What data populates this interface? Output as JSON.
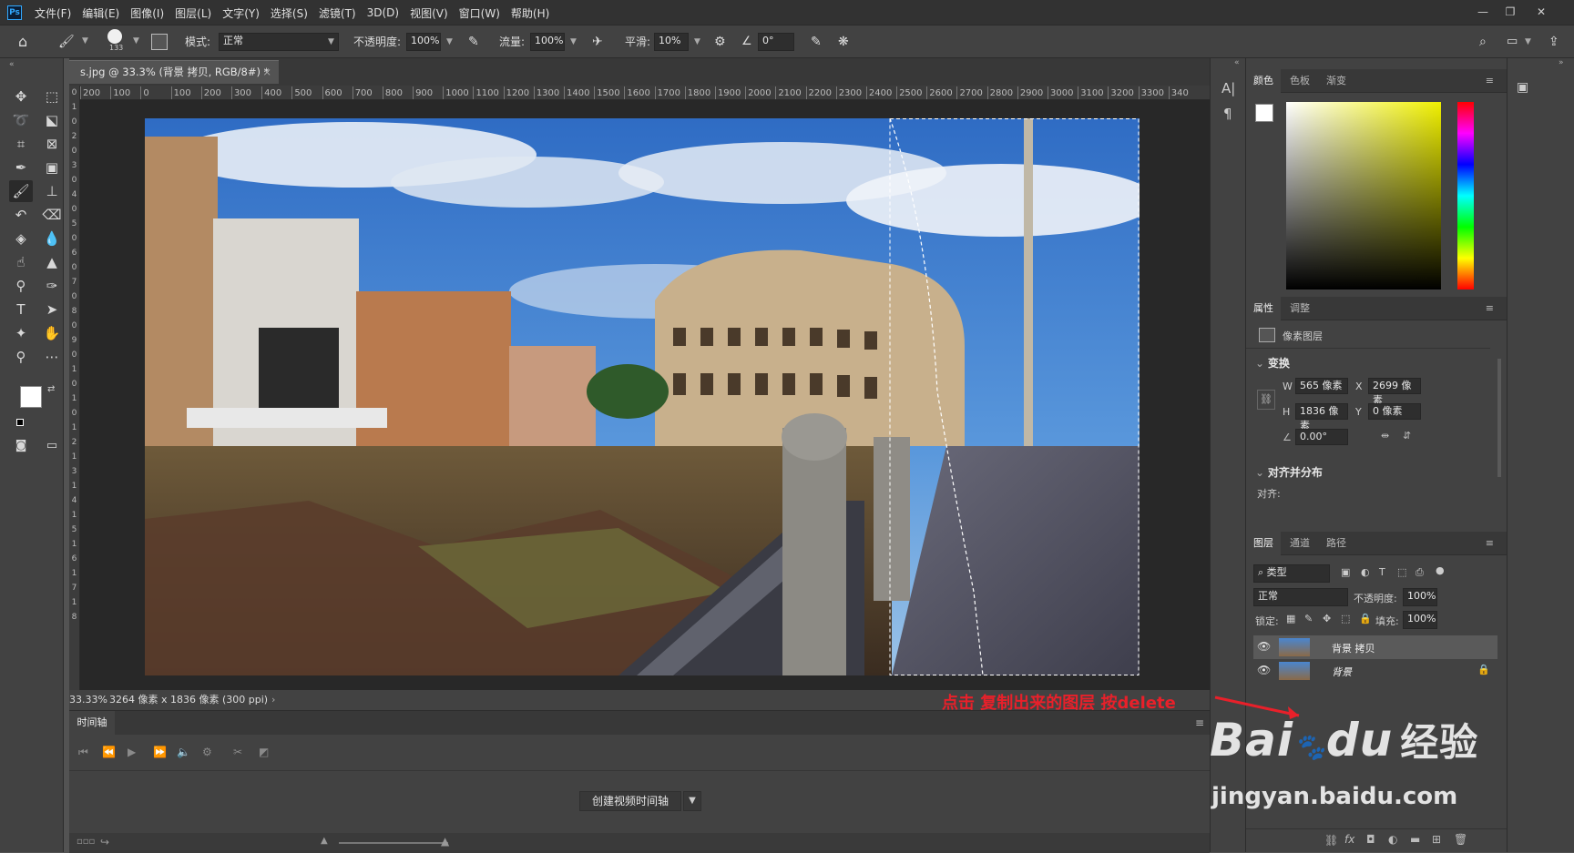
{
  "menubar": {
    "logo": "Ps",
    "items": [
      "文件(F)",
      "编辑(E)",
      "图像(I)",
      "图层(L)",
      "文字(Y)",
      "选择(S)",
      "滤镜(T)",
      "3D(D)",
      "视图(V)",
      "窗口(W)",
      "帮助(H)"
    ],
    "minimize": "—",
    "restore": "❐",
    "close": "✕"
  },
  "options": {
    "brush_size": "133",
    "mode_label": "模式:",
    "mode_value": "正常",
    "opacity_label": "不透明度:",
    "opacity_value": "100%",
    "flow_label": "流量:",
    "flow_value": "100%",
    "smooth_label": "平滑:",
    "smooth_value": "10%",
    "angle_value": "0°"
  },
  "document": {
    "tab_title": "s.jpg @ 33.3% (背景 拷贝, RGB/8#) *",
    "tab_close": "×",
    "zoom": "33.33%",
    "size_info": "3264 像素 x 1836 像素 (300 ppi)",
    "status_arrow": "›"
  },
  "ruler": {
    "h_ticks": [
      "200",
      "100",
      "0",
      "100",
      "200",
      "300",
      "400",
      "500",
      "600",
      "700",
      "800",
      "900",
      "1000",
      "1100",
      "1200",
      "1300",
      "1400",
      "1500",
      "1600",
      "1700",
      "1800",
      "1900",
      "2000",
      "2100",
      "2200",
      "2300",
      "2400",
      "2500",
      "2600",
      "2700",
      "2800",
      "2900",
      "3000",
      "3100",
      "3200",
      "3300",
      "340"
    ],
    "v_ticks": [
      "0",
      "1",
      "0",
      "2",
      "0",
      "3",
      "0",
      "4",
      "0",
      "5",
      "0",
      "6",
      "0",
      "7",
      "0",
      "8",
      "0",
      "9",
      "0",
      "1",
      "0",
      "1",
      "0",
      "1",
      "2",
      "1",
      "3",
      "1",
      "4",
      "1",
      "5",
      "1",
      "6",
      "1",
      "7",
      "1",
      "8"
    ]
  },
  "timeline": {
    "tab": "时间轴",
    "create_button": "创建视频时间轴"
  },
  "color_panel": {
    "tabs": [
      "颜色",
      "色板",
      "渐变"
    ]
  },
  "properties_panel": {
    "tabs": [
      "属性",
      "调整"
    ],
    "layer_type": "像素图层",
    "transform_title": "变换",
    "w_label": "W",
    "w_value": "565 像素",
    "x_label": "X",
    "x_value": "2699 像素",
    "h_label": "H",
    "h_value": "1836 像素",
    "y_label": "Y",
    "y_value": "0 像素",
    "angle_value": "0.00°",
    "align_title": "对齐并分布",
    "align_label": "对齐:"
  },
  "layers_panel": {
    "tabs": [
      "图层",
      "通道",
      "路径"
    ],
    "filter_kind": "类型",
    "blend_mode": "正常",
    "opacity_label": "不透明度:",
    "opacity_value": "100%",
    "lock_label": "锁定:",
    "fill_label": "填充:",
    "fill_value": "100%",
    "layers": [
      {
        "name": "背景 拷贝",
        "selected": true
      },
      {
        "name": "背景",
        "selected": false
      }
    ]
  },
  "annotation": {
    "text": "点击 复制出来的图层 按delete",
    "color": "#e8202a"
  },
  "watermark": {
    "brand": "Bai",
    "brand2": "du",
    "suffix": "经验",
    "url": "jingyan.baidu.com"
  },
  "colors": {
    "accent": "#31a8ff",
    "panel_bg": "#424242",
    "canvas_bg": "#282828"
  }
}
